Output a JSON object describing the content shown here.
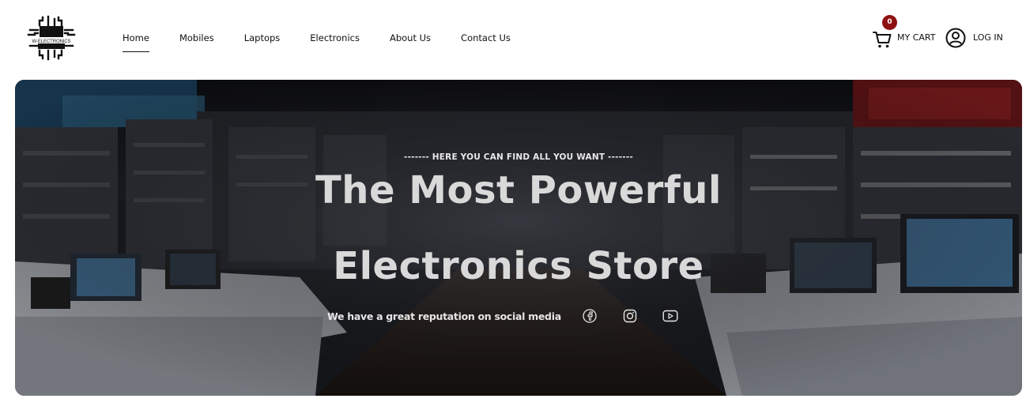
{
  "brand": {
    "logo_text": "W-ELECTRONICS"
  },
  "nav": {
    "items": [
      {
        "label": "Home",
        "active": true
      },
      {
        "label": "Mobiles"
      },
      {
        "label": "Laptops"
      },
      {
        "label": "Electronics"
      },
      {
        "label": "About Us"
      },
      {
        "label": "Contact Us"
      }
    ]
  },
  "cart": {
    "count": "0",
    "label": "MY CART",
    "icon": "cart-icon"
  },
  "account": {
    "label": "LOG IN",
    "icon": "user-circle-icon"
  },
  "hero": {
    "eyebrow": "------- HERE YOU CAN FIND ALL YOU WANT -------",
    "title_line1": "The Most Powerful",
    "title_line2": "Electronics Store",
    "social_text": "We have a great reputation on social media",
    "social_icons": [
      "facebook-icon",
      "instagram-icon",
      "youtube-icon"
    ]
  },
  "colors": {
    "badge": "#8e1111",
    "hero_text": "#d9d9d9",
    "text": "#111111"
  }
}
